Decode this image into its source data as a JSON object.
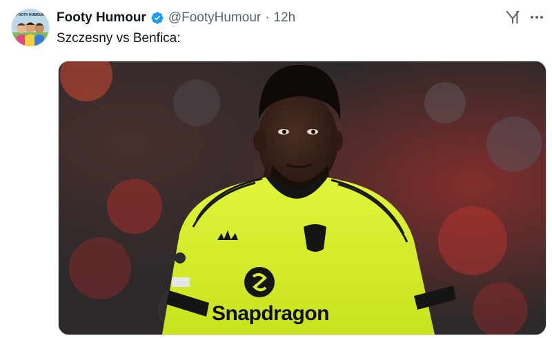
{
  "tweet": {
    "author_name": "Footy Humour",
    "handle": "@FootyHumour",
    "separator": "·",
    "time": "12h",
    "text": "Szczesny vs Benfica:",
    "avatar_label": "FOOTY HUMOUR"
  },
  "media": {
    "description_icon": "photo",
    "shirt_sponsor": "Snapdragon",
    "colors": {
      "jersey": "#d8f02a",
      "trim": "#151515",
      "background_red": "#b02a28"
    }
  },
  "icons": {
    "grok": "grok-icon",
    "more": "more-icon",
    "verified": "verified-badge-icon"
  },
  "colors": {
    "verified": "#1d9bf0",
    "secondary_text": "#536471"
  }
}
